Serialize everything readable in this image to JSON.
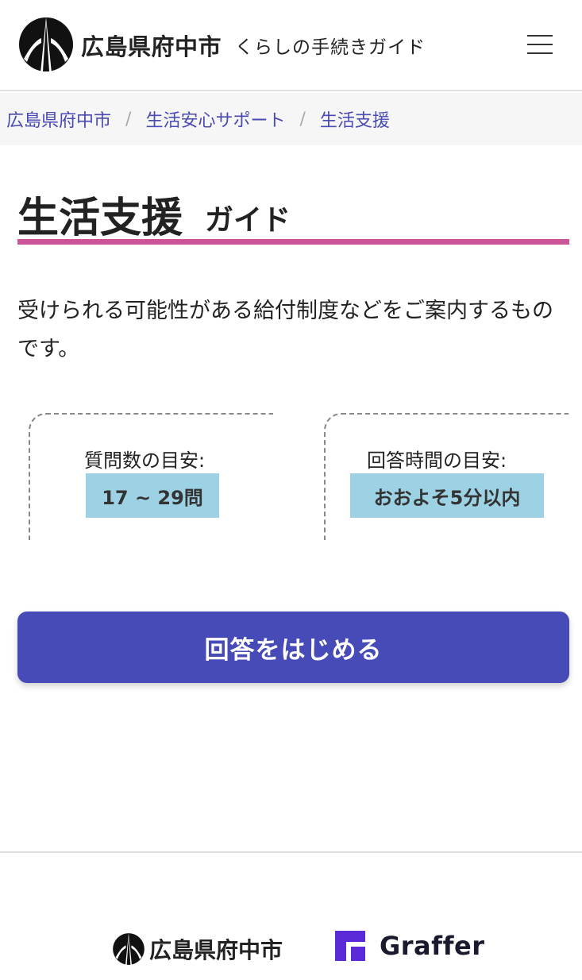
{
  "header": {
    "site_name": "広島県府中市",
    "site_sub": "くらしの手続きガイド",
    "menu_icon": "hamburger-menu-icon"
  },
  "breadcrumb": {
    "items": [
      "広島県府中市",
      "生活安心サポート",
      "生活支援"
    ],
    "separator": "/"
  },
  "page": {
    "title": "生活支援",
    "title_suffix": "ガイド",
    "description": "受けられる可能性がある給付制度などをご案内するものです。"
  },
  "cards": [
    {
      "label": "質問数の目安:",
      "value": "17 ~ 29問"
    },
    {
      "label": "回答時間の目安:",
      "value": "おおよそ5分以内"
    }
  ],
  "start_button": {
    "label": "回答をはじめる"
  },
  "footer": {
    "city_name": "広島県府中市",
    "partner_name": "Graffer"
  },
  "colors": {
    "accent_purple": "#474bb8",
    "title_underline": "#cc559a",
    "badge_blue": "#9dd1e4",
    "link": "#4a4ab4",
    "graffer_purple": "#5a2bd6"
  }
}
